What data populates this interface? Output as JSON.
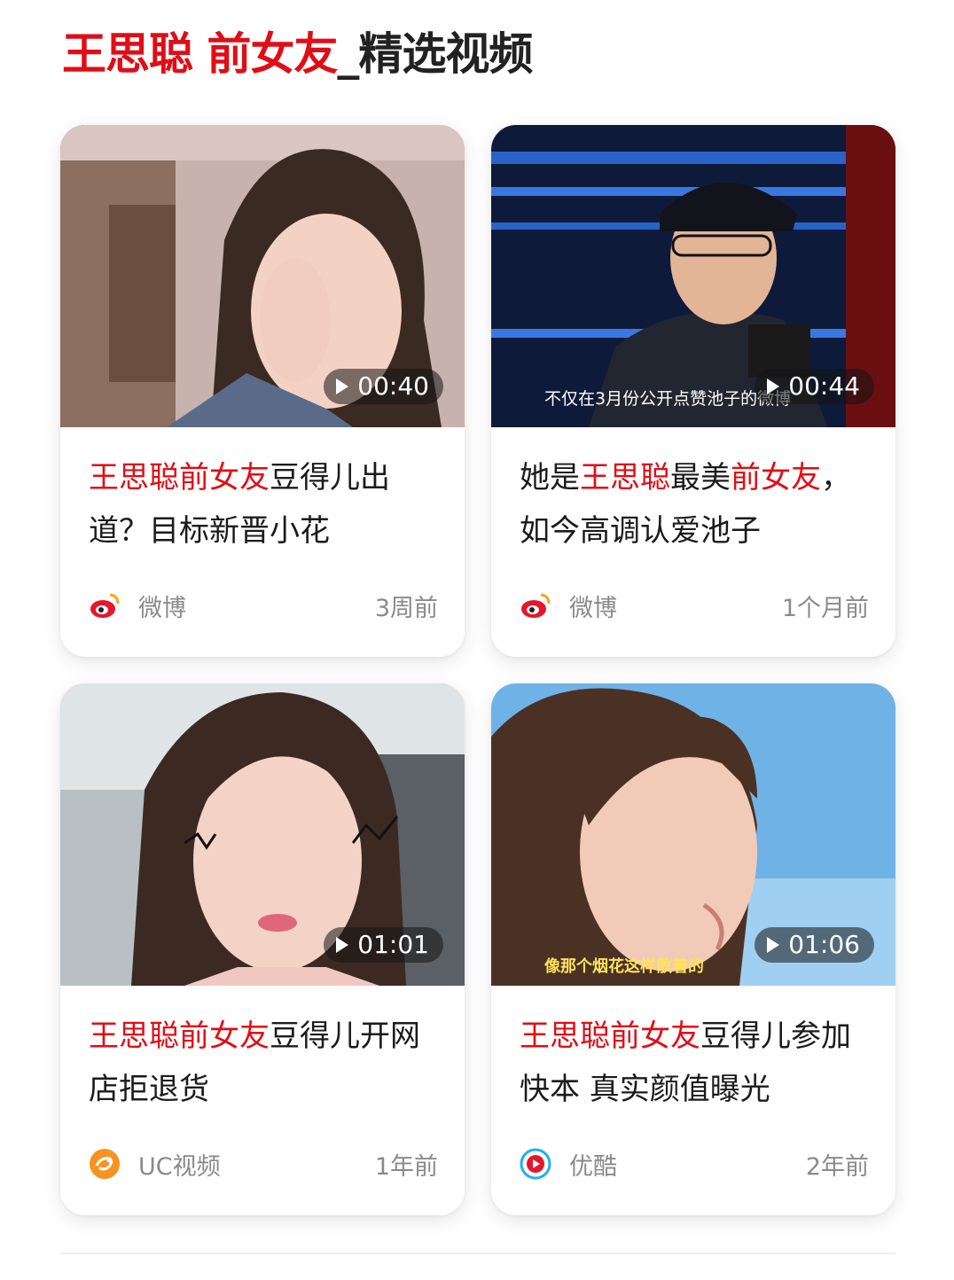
{
  "header": {
    "highlight": "王思聪 前女友",
    "rest": "_精选视频"
  },
  "cards": [
    {
      "duration": "00:40",
      "title_kw": "王思聪前女友",
      "title_rest": "豆得儿出道？目标新晋小花",
      "source": "微博",
      "source_icon": "weibo-icon",
      "time": "3周前"
    },
    {
      "duration": "00:44",
      "title_pre": "她是",
      "title_kw": "王思聪",
      "title_mid": "最美",
      "title_kw2": "前女友",
      "title_rest": "，如今高调认爱池子",
      "source": "微博",
      "source_icon": "weibo-icon",
      "time": "1个月前"
    },
    {
      "duration": "01:01",
      "title_kw": "王思聪前女友",
      "title_rest": "豆得儿开网店拒退货",
      "source": "UC视频",
      "source_icon": "uc-video-icon",
      "time": "1年前"
    },
    {
      "duration": "01:06",
      "title_kw": "王思聪前女友",
      "title_rest": "豆得儿参加快本 真实颜值曝光",
      "source": "优酷",
      "source_icon": "youku-icon",
      "time": "2年前"
    }
  ],
  "colors": {
    "accent": "#e10d16",
    "text": "#1b1b1b",
    "muted": "#8a8a8a"
  }
}
